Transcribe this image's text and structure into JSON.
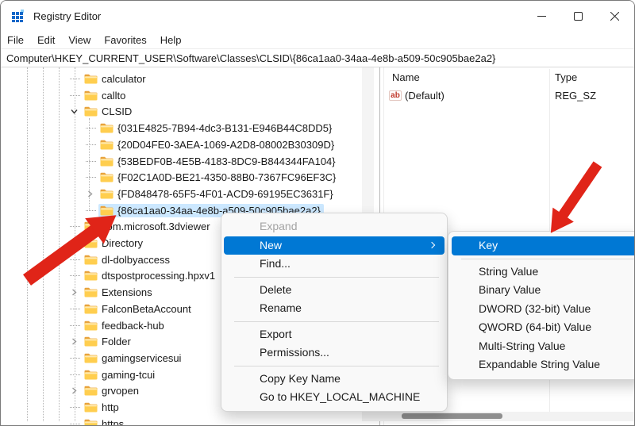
{
  "window": {
    "title": "Registry Editor",
    "controls": {
      "minimize": "minimize",
      "maximize": "maximize",
      "close": "close"
    }
  },
  "menubar": {
    "items": [
      "File",
      "Edit",
      "View",
      "Favorites",
      "Help"
    ]
  },
  "address": {
    "value": "Computer\\HKEY_CURRENT_USER\\Software\\Classes\\CLSID\\{86ca1aa0-34aa-4e8b-a509-50c905bae2a2}"
  },
  "tree": {
    "items": [
      {
        "label": "calculator",
        "depth": 0,
        "chevron": "none"
      },
      {
        "label": "callto",
        "depth": 0,
        "chevron": "none"
      },
      {
        "label": "CLSID",
        "depth": 0,
        "chevron": "down"
      },
      {
        "label": "{031E4825-7B94-4dc3-B131-E946B44C8DD5}",
        "depth": 1,
        "chevron": "none"
      },
      {
        "label": "{20D04FE0-3AEA-1069-A2D8-08002B30309D}",
        "depth": 1,
        "chevron": "none"
      },
      {
        "label": "{53BEDF0B-4E5B-4183-8DC9-B844344FA104}",
        "depth": 1,
        "chevron": "none"
      },
      {
        "label": "{F02C1A0D-BE21-4350-88B0-7367FC96EF3C}",
        "depth": 1,
        "chevron": "none"
      },
      {
        "label": "{FD848478-65F5-4F01-ACD9-69195EC3631F}",
        "depth": 1,
        "chevron": "right"
      },
      {
        "label": "{86ca1aa0-34aa-4e8b-a509-50c905bae2a2}",
        "depth": 1,
        "chevron": "none",
        "selected": true
      },
      {
        "label": "com.microsoft.3dviewer",
        "depth": 0,
        "chevron": "none"
      },
      {
        "label": "Directory",
        "depth": 0,
        "chevron": "right"
      },
      {
        "label": "dl-dolbyaccess",
        "depth": 0,
        "chevron": "none"
      },
      {
        "label": "dtspostprocessing.hpxv1",
        "depth": 0,
        "chevron": "none"
      },
      {
        "label": "Extensions",
        "depth": 0,
        "chevron": "right"
      },
      {
        "label": "FalconBetaAccount",
        "depth": 0,
        "chevron": "none"
      },
      {
        "label": "feedback-hub",
        "depth": 0,
        "chevron": "none"
      },
      {
        "label": "Folder",
        "depth": 0,
        "chevron": "right"
      },
      {
        "label": "gamingservicesui",
        "depth": 0,
        "chevron": "none"
      },
      {
        "label": "gaming-tcui",
        "depth": 0,
        "chevron": "none"
      },
      {
        "label": "grvopen",
        "depth": 0,
        "chevron": "right"
      },
      {
        "label": "http",
        "depth": 0,
        "chevron": "none"
      },
      {
        "label": "https",
        "depth": 0,
        "chevron": "none"
      }
    ]
  },
  "values_pane": {
    "columns": {
      "name": "Name",
      "type": "Type"
    },
    "rows": [
      {
        "icon": "string-value-ab-icon",
        "name": "(Default)",
        "type": "REG_SZ"
      }
    ]
  },
  "context_menu": {
    "items": [
      {
        "label": "Expand",
        "state": "disabled"
      },
      {
        "label": "New",
        "state": "highlighted",
        "submenu_arrow": true
      },
      {
        "label": "Find...",
        "state": "normal"
      },
      {
        "separator": true
      },
      {
        "label": "Delete",
        "state": "normal"
      },
      {
        "label": "Rename",
        "state": "normal"
      },
      {
        "separator": true
      },
      {
        "label": "Export",
        "state": "normal"
      },
      {
        "label": "Permissions...",
        "state": "normal"
      },
      {
        "separator": true
      },
      {
        "label": "Copy Key Name",
        "state": "normal"
      },
      {
        "label": "Go to HKEY_LOCAL_MACHINE",
        "state": "normal"
      }
    ]
  },
  "submenu": {
    "items": [
      {
        "label": "Key",
        "state": "highlighted"
      },
      {
        "separator": true
      },
      {
        "label": "String Value",
        "state": "normal"
      },
      {
        "label": "Binary Value",
        "state": "normal"
      },
      {
        "label": "DWORD (32-bit) Value",
        "state": "normal"
      },
      {
        "label": "QWORD (64-bit) Value",
        "state": "normal"
      },
      {
        "label": "Multi-String Value",
        "state": "normal"
      },
      {
        "label": "Expandable String Value",
        "state": "normal"
      }
    ]
  },
  "icons": {
    "app": "registry-grid-icon",
    "tree_folder": "folder-icon",
    "value_type": "string-value-ab-icon",
    "annotations": [
      "red-arrow-to-selected-key",
      "red-arrow-to-key-menu-item"
    ]
  },
  "colors": {
    "menu_highlight": "#0078d4",
    "tree_selection": "#cce8ff",
    "annotation_arrow": "#e02418",
    "folder_yellow": "#ffce4f",
    "disabled_text": "#a3a3a3"
  }
}
